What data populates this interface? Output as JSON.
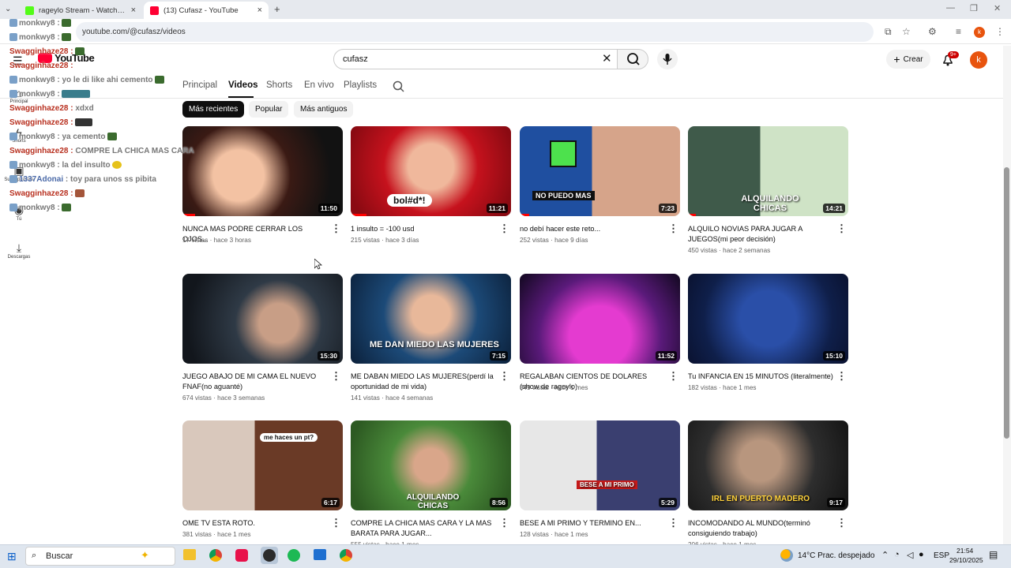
{
  "browser": {
    "tabs": [
      {
        "title": "rageylo Stream - Watch Live on Kick",
        "close": "×"
      },
      {
        "title": "(13) Cufasz - YouTube",
        "close": "×"
      }
    ],
    "new_tab": "+",
    "url": "youtube.com/@cufasz/videos"
  },
  "youtube": {
    "logo": "YouTube",
    "search_value": "cufasz",
    "create_label": "Crear",
    "notif_badge": "9+",
    "avatar_letter": "k",
    "sidebar": [
      {
        "label": "Principal"
      },
      {
        "label": "Shorts"
      },
      {
        "label": "Suscripciones"
      },
      {
        "label": "Tú"
      },
      {
        "label": "Descargas"
      }
    ],
    "channel_tabs": [
      "Principal",
      "Videos",
      "Shorts",
      "En vivo",
      "Playlists"
    ],
    "chips": [
      "Más recientes",
      "Popular",
      "Más antiguos"
    ],
    "videos": [
      {
        "title": "NUNCA MAS PODRE CERRAR LOS OJOS...",
        "meta": "17 vistas · hace 3 horas",
        "duration": "11:50"
      },
      {
        "title": "1 insulto = -100 usd",
        "meta": "215 vistas · hace 3 días",
        "duration": "11:21",
        "thumb_text": "bol#d*!"
      },
      {
        "title": "no debí hacer este reto...",
        "meta": "252 vistas · hace 9 días",
        "duration": "7:23",
        "thumb_text": "NO PUEDO MAS"
      },
      {
        "title": "ALQUILO NOVIAS PARA JUGAR A JUEGOS(mi peor decisión)",
        "meta": "450 vistas · hace 2 semanas",
        "duration": "14:21",
        "thumb_text": "ALQUILANDO CHICAS"
      },
      {
        "title": "JUEGO ABAJO DE MI CAMA EL NUEVO FNAF(no aguanté)",
        "meta": "674 vistas · hace 3 semanas",
        "duration": "15:30"
      },
      {
        "title": "ME DABAN MIEDO LAS MUJERES(perdí la oportunidad de mi vida)",
        "meta": "141 vistas · hace 4 semanas",
        "duration": "7:15",
        "thumb_text": "ME DAN MIEDO LAS MUJERES"
      },
      {
        "title": "REGALABAN CIENTOS DE DOLARES (show de rageylo)",
        "meta": "349 vistas · hace 1 mes",
        "duration": "11:52"
      },
      {
        "title": "Tu INFANCIA EN 15 MINUTOS (literalmente)",
        "meta": "182 vistas · hace 1 mes",
        "duration": "15:10"
      },
      {
        "title": "OME TV ESTA ROTO.",
        "meta": "381 vistas · hace 1 mes",
        "duration": "6:17",
        "thumb_text": "me haces un pt?"
      },
      {
        "title": "COMPRE LA CHICA MAS CARA Y LA MAS BARATA PARA JUGAR...",
        "meta": "555 vistas · hace 1 mes",
        "duration": "8:56",
        "thumb_text": "ALQUILANDO CHICAS"
      },
      {
        "title": "BESE A MI PRIMO Y TERMINO EN...",
        "meta": "128 vistas · hace 1 mes",
        "duration": "5:29",
        "thumb_text": "BESE A MI PRIMO"
      },
      {
        "title": "INCOMODANDO AL MUNDO(terminó consiguiendo trabajo)",
        "meta": "206 vistas · hace 1 mes",
        "duration": "9:17",
        "thumb_text": "IRL EN PUERTO MADERO"
      }
    ]
  },
  "chat_overlay": [
    {
      "user": "monkwy8",
      "msg": ""
    },
    {
      "user": "monkwy8",
      "msg": ""
    },
    {
      "user": "Swagginhaze28",
      "msg": ""
    },
    {
      "user": "Swagginhaze28",
      "msg": ""
    },
    {
      "user": "monkwy8",
      "msg": "yo le di like ahi cemento"
    },
    {
      "user": "monkwy8",
      "msg": ""
    },
    {
      "user": "Swagginhaze28",
      "msg": "xdxd"
    },
    {
      "user": "Swagginhaze28",
      "msg": ""
    },
    {
      "user": "monkwy8",
      "msg": "ya cemento"
    },
    {
      "user": "Swagginhaze28",
      "msg": "COMPRE LA CHICA MAS CARA"
    },
    {
      "user": "monkwy8",
      "msg": "la del insulto"
    },
    {
      "user": "1337Adonai",
      "msg": "toy para unos ss pibita"
    },
    {
      "user": "Swagginhaze28",
      "msg": ""
    },
    {
      "user": "monkwy8",
      "msg": ""
    }
  ],
  "taskbar": {
    "search": "Buscar",
    "weather": "14°C  Prac. despejado",
    "lang": "ESP",
    "time": "21:54",
    "date": "29/10/2025"
  }
}
